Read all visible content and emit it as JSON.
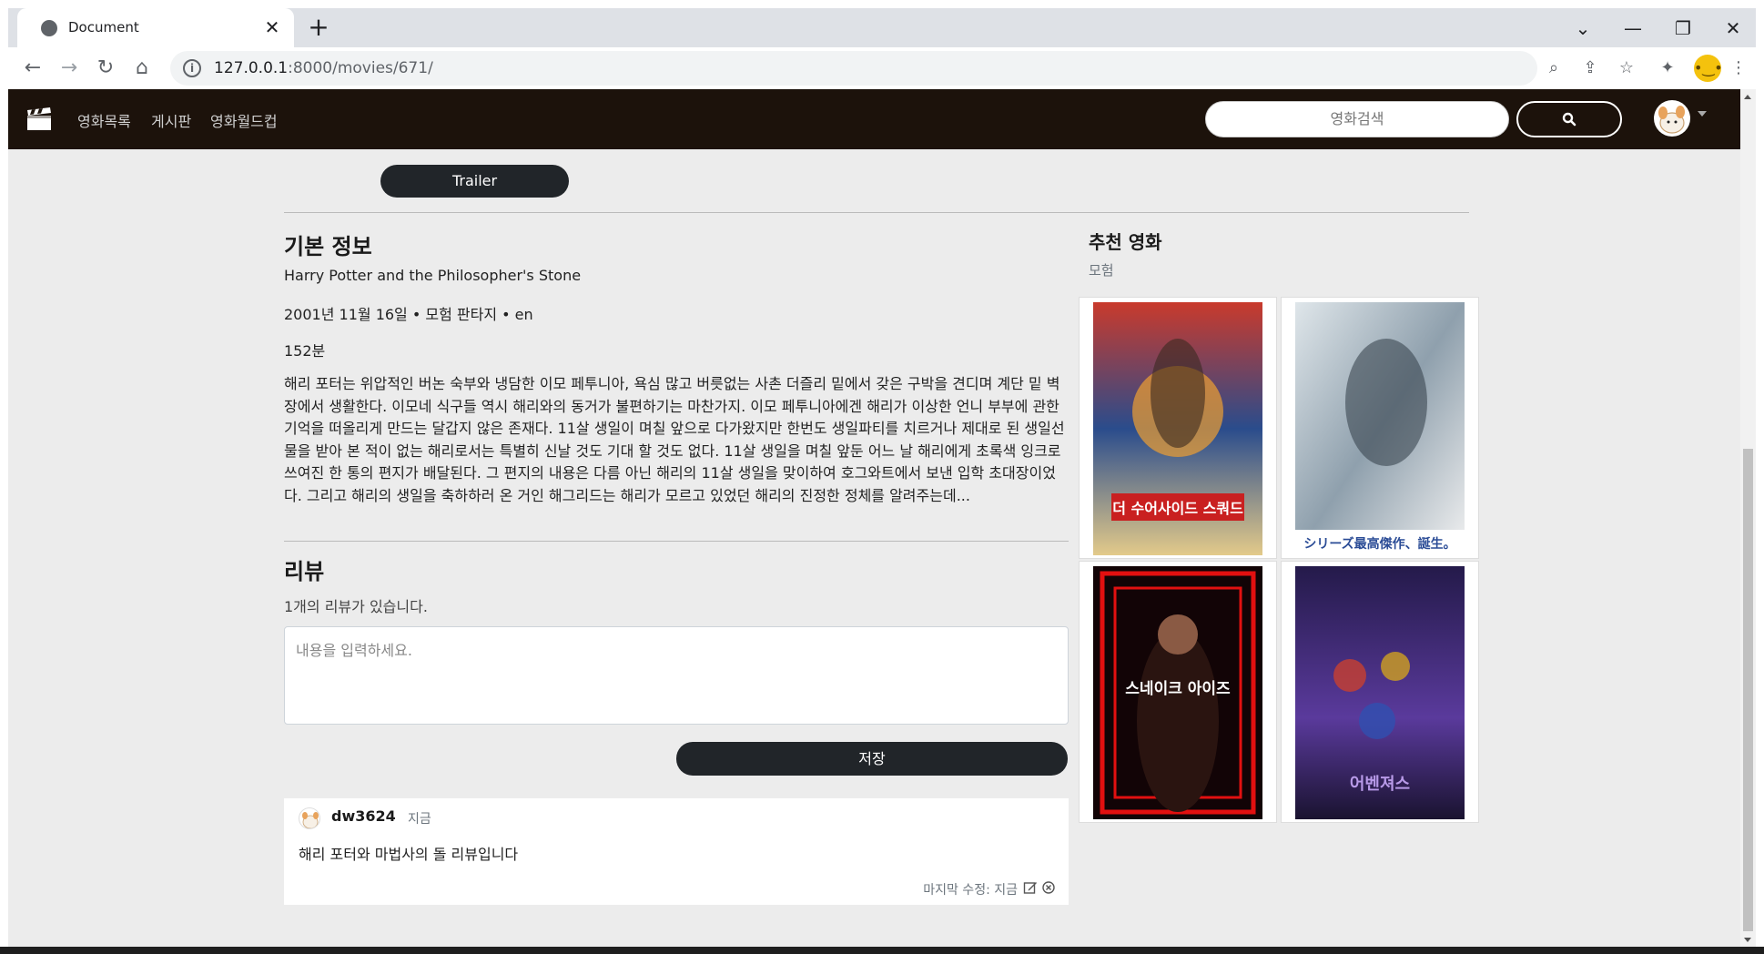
{
  "browser": {
    "tab_title": "Document",
    "url_host": "127.0.0.1",
    "url_path": ":8000/movies/671/"
  },
  "navbar": {
    "links": [
      "영화목록",
      "게시판",
      "영화월드컵"
    ],
    "search_placeholder": "영화검색"
  },
  "movie": {
    "trailer_label": "Trailer",
    "section_title": "기본 정보",
    "original_title": "Harry Potter and the Philosopher's Stone",
    "meta": "2001년 11월 16일 • 모험 판타지 • en",
    "runtime": "152분",
    "overview": "해리 포터는 위압적인 버논 숙부와 냉담한 이모 페투니아, 욕심 많고 버릇없는 사촌 더즐리 밑에서 갖은 구박을 견디며 계단 밑 벽장에서 생활한다. 이모네 식구들 역시 해리와의 동거가 불편하기는 마찬가지. 이모 페투니아에겐 해리가 이상한 언니 부부에 관한 기억을 떠올리게 만드는 달갑지 않은 존재다. 11살 생일이 며칠 앞으로 다가왔지만 한번도 생일파티를 치르거나 제대로 된 생일선물을 받아 본 적이 없는 해리로서는 특별히 신날 것도 기대 할 것도 없다. 11살 생일을 며칠 앞둔 어느 날 해리에게 초록색 잉크로 쓰여진 한 통의 편지가 배달된다. 그 편지의 내용은 다름 아닌 해리의 11살 생일을 맞이하여 호그와트에서 보낸 입학 초대장이었다. 그리고 해리의 생일을 축하하러 온 거인 해그리드는 해리가 모르고 있었던 해리의 진정한 정체를 알려주는데..."
  },
  "reviews": {
    "title": "리뷰",
    "count_text": "1개의 리뷰가 있습니다.",
    "textarea_placeholder": "내용을 입력하세요.",
    "save_label": "저장",
    "items": [
      {
        "user": "dw3624",
        "time": "지금",
        "content": "해리 포터와 마법사의 돌 리뷰입니다",
        "modified": "마지막 수정: 지금"
      }
    ]
  },
  "recommend": {
    "title": "추천 영화",
    "genre": "모험",
    "posters": [
      {
        "name": "poster-suicide-squad",
        "text": "더 수어사이드 스쿼드"
      },
      {
        "name": "poster-rurouni-kenshin",
        "text": "シリーズ最高傑作、誕生。"
      },
      {
        "name": "poster-snake-eyes",
        "text": "스네이크 아이즈"
      },
      {
        "name": "poster-avengers",
        "text": "어벤져스"
      }
    ]
  },
  "colors": {
    "navbar_bg": "#1c120b",
    "page_bg": "#ececec",
    "button_dark": "#212529"
  }
}
